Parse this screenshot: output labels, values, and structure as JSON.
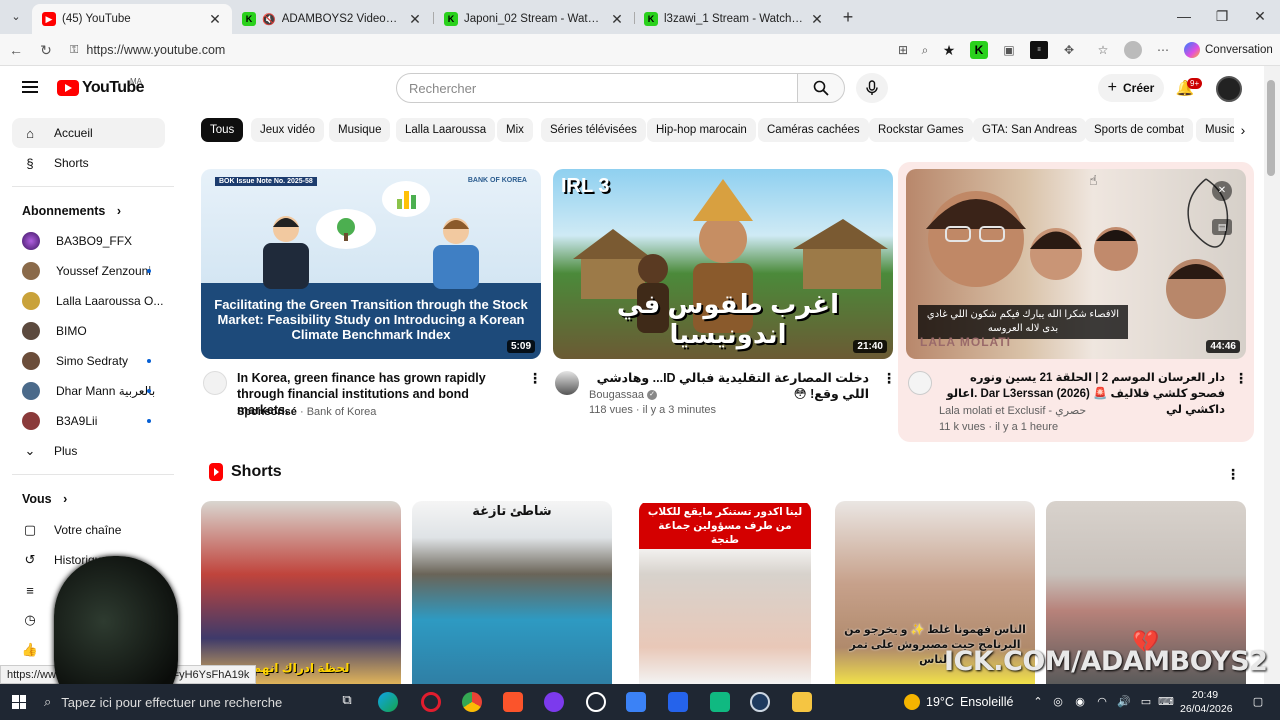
{
  "browser": {
    "tabs": [
      {
        "title": "(45) YouTube",
        "favicon": "youtube-icon",
        "active": true
      },
      {
        "title": "ADAMBOYS2 Videos - Watch",
        "favicon": "kick-icon",
        "muted": true
      },
      {
        "title": "Japoni_02 Stream - Watch Live on",
        "favicon": "kick-icon"
      },
      {
        "title": "l3zawi_1 Stream - Watch Live on K",
        "favicon": "kick-icon"
      }
    ],
    "url": "https://www.youtube.com",
    "conversation_label": "Conversation"
  },
  "youtube": {
    "logo_text": "YouTube",
    "country_code": "MA",
    "search_placeholder": "Rechercher",
    "create_label": "Créer",
    "notifications_badge": "9+",
    "colors": {
      "brand": "#ff0000",
      "chip_selected": "#0f0f0f",
      "sponsored_link": "#065fd4"
    }
  },
  "sidebar": {
    "main": [
      {
        "label": "Accueil",
        "icon": "home-icon",
        "selected": true
      },
      {
        "label": "Shorts",
        "icon": "shorts-icon"
      }
    ],
    "subscriptions_header": "Abonnements",
    "subscriptions": [
      {
        "label": "BA3BO9_FFX",
        "live": false
      },
      {
        "label": "Youssef Zenzouni",
        "live": true
      },
      {
        "label": "Lalla Laaroussa O...",
        "live": false
      },
      {
        "label": "BIMO",
        "live": false
      },
      {
        "label": "Simo Sedraty",
        "live": true
      },
      {
        "label": "Dhar Mann بالعربية",
        "live": true
      },
      {
        "label": "B3A9Lii",
        "live": true
      }
    ],
    "more_label": "Plus",
    "you_header": "Vous",
    "you_items": [
      {
        "label": "Votre chaîne",
        "icon": "channel-icon"
      },
      {
        "label": "Historique",
        "icon": "history-icon"
      },
      {
        "label": "",
        "icon": "playlists-icon"
      },
      {
        "label": "",
        "icon": "watch-later-icon"
      },
      {
        "label": "",
        "icon": "liked-icon"
      }
    ]
  },
  "chips": [
    "Tous",
    "Jeux vidéo",
    "Musique",
    "Lalla Laaroussa",
    "Mix",
    "Séries télévisées",
    "Hip-hop marocain",
    "Caméras cachées",
    "Rockstar Games",
    "GTA: San Andreas",
    "Sports de combat",
    "Music"
  ],
  "videos": [
    {
      "thumb_badge": "BOK Issue Note No. 2025-58",
      "thumb_logo": "BANK OF KOREA",
      "thumb_text": "Facilitating the Green Transition through the Stock Market: Feasibility Study on Introducing a Korean Climate Benchmark Index",
      "duration": "5:09",
      "title": "In Korea, green finance has grown rapidly through financial institutions and bond markets.",
      "sponsored": "Sponsorisé",
      "channel": "Bank of Korea"
    },
    {
      "thumb_tag": "IRL 3",
      "thumb_text": "اغرب طقوس في اندونيسيا",
      "duration": "21:40",
      "title": "دخلت المصارعة التقليدية فبالي ID... وهادشي اللي وقع! 😳",
      "channel": "Bougassaa",
      "views": "118 vues",
      "age": "il y a 3 minutes"
    },
    {
      "thumb_caption": "الافصاء شكرا الله يبارك فيكم شكون اللي غادي بدى لاله العروسه",
      "thumb_sign": "LALA MOLATI",
      "duration": "44:46",
      "title": "دار العرسان الموسم 2 | الحلقة 21 يسين ونوره فصحو كلشي فلاليف 🚨 Dar L3erssan (2026) .اعالو داكشي لي",
      "channel": "Lala molati et Exclusif - حصري",
      "views": "11 k vues",
      "age": "il y a 1 heure"
    }
  ],
  "shorts": {
    "header": "Shorts",
    "items": [
      {
        "caption": "لحظة ادراك انهم"
      },
      {
        "caption": "شاطئ تازغة"
      },
      {
        "caption": "لينا اكدور تستنكر مايقع للكلاب من طرف مسؤولين جماعة طنجة"
      },
      {
        "caption": "الناس فهمونا غلط ✨ و يخرجو من البرنامج حيت مصبروش على تمر الناس"
      },
      {
        "caption": "💔"
      }
    ]
  },
  "status_url": "https://www.youtube.com/watch?v=yH6YsFhA19k",
  "watermark": "ICK.COM/ADAMBOYS2",
  "taskbar": {
    "search_placeholder": "Tapez ici pour effectuer une recherche",
    "weather_temp": "19°C",
    "weather_text": "Ensoleillé",
    "time": "20:49",
    "date": "26/04/2026"
  }
}
